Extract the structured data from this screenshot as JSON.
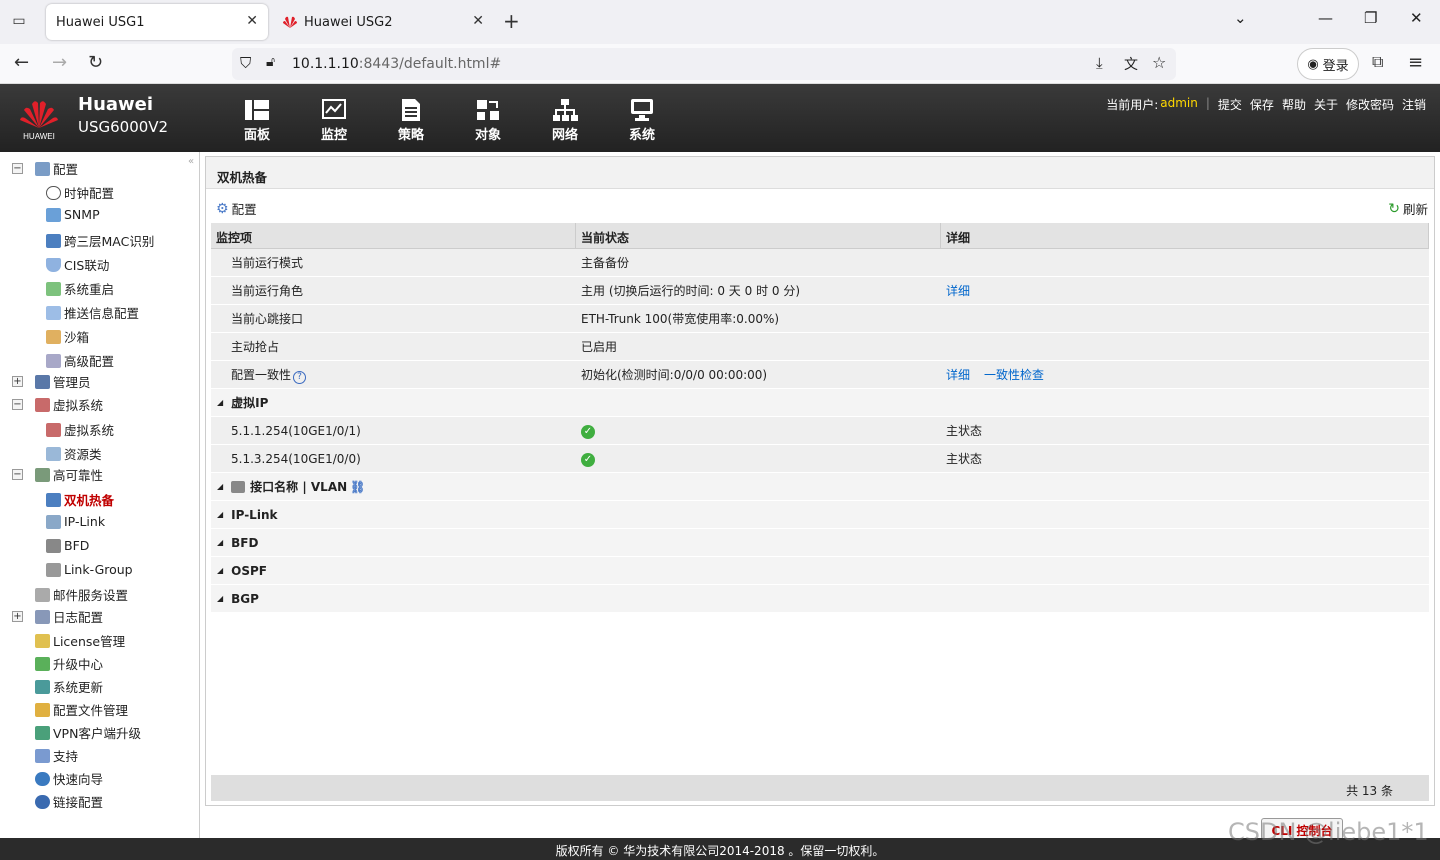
{
  "browser": {
    "tabs": [
      {
        "title": "Huawei USG1"
      },
      {
        "title": "Huawei USG2"
      }
    ],
    "url_host": "10.1.1.10",
    "url_rest": ":8443/default.html#",
    "login_label": "登录"
  },
  "header": {
    "brand_name": "Huawei",
    "logo_text": "HUAWEI",
    "model": "USG6000V2",
    "menu": [
      "面板",
      "监控",
      "策略",
      "对象",
      "网络",
      "系统"
    ],
    "current_user_label": "当前用户:",
    "current_user": "admin",
    "actions": [
      "提交",
      "保存",
      "帮助",
      "关于",
      "修改密码",
      "注销"
    ]
  },
  "sidebar": {
    "items": [
      {
        "label": "配置",
        "toggle": "−"
      },
      {
        "label": "时钟配置"
      },
      {
        "label": "SNMP"
      },
      {
        "label": "跨三层MAC识别"
      },
      {
        "label": "CIS联动"
      },
      {
        "label": "系统重启"
      },
      {
        "label": "推送信息配置"
      },
      {
        "label": "沙箱"
      },
      {
        "label": "高级配置"
      },
      {
        "label": "管理员",
        "toggle": "+"
      },
      {
        "label": "虚拟系统",
        "toggle": "−"
      },
      {
        "label": "虚拟系统"
      },
      {
        "label": "资源类"
      },
      {
        "label": "高可靠性",
        "toggle": "−"
      },
      {
        "label": "双机热备"
      },
      {
        "label": "IP-Link"
      },
      {
        "label": "BFD"
      },
      {
        "label": "Link-Group"
      },
      {
        "label": "邮件服务设置"
      },
      {
        "label": "日志配置",
        "toggle": "+"
      },
      {
        "label": "License管理"
      },
      {
        "label": "升级中心"
      },
      {
        "label": "系统更新"
      },
      {
        "label": "配置文件管理"
      },
      {
        "label": "VPN客户端升级"
      },
      {
        "label": "支持"
      },
      {
        "label": "快速向导"
      },
      {
        "label": "链接配置"
      }
    ]
  },
  "main": {
    "title": "双机热备",
    "config_label": "配置",
    "refresh_label": "刷新",
    "columns": [
      "监控项",
      "当前状态",
      "详细"
    ],
    "rows": [
      {
        "item": "当前运行模式",
        "status": "主备备份"
      },
      {
        "item": "当前运行角色",
        "status": "主用 (切换后运行的时间: 0 天 0 时 0 分)",
        "links": [
          "详细"
        ]
      },
      {
        "item": "当前心跳接口",
        "status": "ETH-Trunk 100(带宽使用率:0.00%)"
      },
      {
        "item": "主动抢占",
        "status": "已启用"
      },
      {
        "item": "配置一致性",
        "help": "?",
        "status": "初始化(检测时间:0/0/0 00:00:00)",
        "links": [
          "详细",
          "一致性检查"
        ]
      }
    ],
    "vip_group": "虚拟IP",
    "vip_rows": [
      {
        "item": "5.1.1.254(10GE1/0/1)",
        "detail": "主状态"
      },
      {
        "item": "5.1.3.254(10GE1/0/0)",
        "detail": "主状态"
      }
    ],
    "groups": [
      "接口名称 | VLAN",
      "IP-Link",
      "BFD",
      "OSPF",
      "BGP"
    ],
    "total": "共 13 条"
  },
  "cli_label": "CLI 控制台",
  "copyright": "版权所有 © 华为技术有限公司2014-2018 。保留一切权利。",
  "watermark": "CSDN @liebe1*1",
  "colors": {
    "accent_red": "#c00000",
    "link_blue": "#0066cc",
    "header_bg": "#2b2b2b",
    "user_yellow": "#ffd800"
  }
}
